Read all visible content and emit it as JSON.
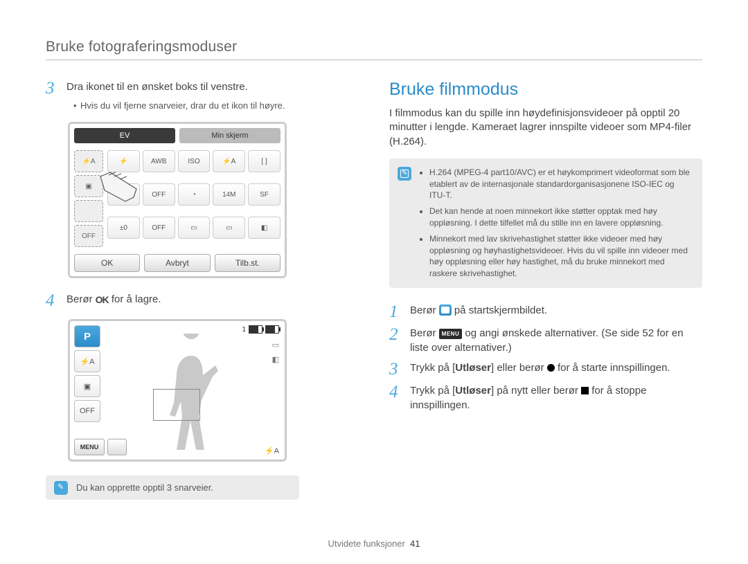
{
  "header": {
    "title": "Bruke fotograferingsmoduser"
  },
  "left": {
    "step3": {
      "num": "3",
      "text": "Dra ikonet til en ønsket boks til venstre.",
      "bullet": "Hvis du vil fjerne snarveier, drar du et ikon til høyre."
    },
    "fig1": {
      "tab_ev": "EV",
      "tab_min": "Min skjerm",
      "btn_ok": "OK",
      "btn_cancel": "Avbryt",
      "btn_reset": "Tilb.st."
    },
    "step4": {
      "num": "4",
      "pre": "Berør",
      "ok": "OK",
      "post": " for å lagre."
    },
    "fig2": {
      "mode": "P",
      "menu": "MENU",
      "count": "1",
      "flash_auto": "⚡A"
    },
    "note_small": "Du kan opprette opptil 3 snarveier."
  },
  "right": {
    "heading": "Bruke filmmodus",
    "intro": "I filmmodus kan du spille inn høydefinisjonsvideoer på opptil 20 minutter i lengde. Kameraet lagrer innspilte videoer som MP4-filer (H.264).",
    "notes": [
      "H.264 (MPEG-4 part10/AVC) er et høykomprimert videoformat som ble etablert av de internasjonale standardorganisasjonene ISO-IEC og ITU-T.",
      "Det kan hende at noen minnekort ikke støtter opptak med høy oppløsning. I dette tilfellet må du stille inn en lavere oppløsning.",
      "Minnekort med lav skrivehastighet støtter ikke videoer med høy oppløsning og høyhastighetsvideoer. Hvis du vil spille inn videoer med høy oppløsning eller høy hastighet, må du bruke minnekort med raskere skrivehastighet."
    ],
    "steps": {
      "s1": {
        "num": "1",
        "pre": "Berør ",
        "post": " på startskjermbildet."
      },
      "s2": {
        "num": "2",
        "pre": "Berør ",
        "menu": "MENU",
        "post": " og angi ønskede alternativer. (Se side 52 for en liste over alternativer.)"
      },
      "s3": {
        "num": "3",
        "pre": "Trykk på [",
        "bold": "Utløser",
        "mid": "] eller berør ",
        "post": " for å starte innspillingen."
      },
      "s4": {
        "num": "4",
        "pre": "Trykk på [",
        "bold": "Utløser",
        "mid": "] på nytt eller berør ",
        "post": " for å stoppe innspillingen."
      }
    }
  },
  "footer": {
    "section": "Utvidete funksjoner",
    "page": "41"
  }
}
